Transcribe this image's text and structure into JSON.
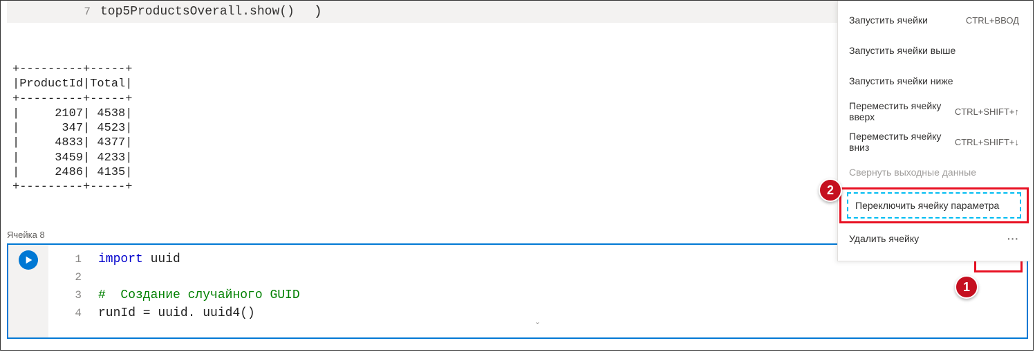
{
  "top_cell": {
    "lineno": "7",
    "code": "top5ProductsOverall.show()",
    "paren": ")"
  },
  "output": "+---------+-----+\n|ProductId|Total|\n+---------+-----+\n|     2107| 4538|\n|      347| 4523|\n|     4833| 4377|\n|     3459| 4233|\n|     2486| 4135|\n+---------+-----+",
  "cell_label": "Ячейка 8",
  "code_cell": {
    "lines": [
      {
        "ln": "1",
        "segments": [
          {
            "t": "import ",
            "c": "kw"
          },
          {
            "t": "uuid",
            "c": "ident"
          }
        ]
      },
      {
        "ln": "2",
        "segments": []
      },
      {
        "ln": "3",
        "segments": [
          {
            "t": "#  Создание случайного GUID",
            "c": "comment"
          }
        ]
      },
      {
        "ln": "4",
        "segments": [
          {
            "t": "runId = uuid. uuid4()",
            "c": "ident"
          }
        ]
      }
    ]
  },
  "ellipsis": "···",
  "menu": {
    "items": [
      {
        "label": "Запустить ячейки",
        "shortcut": "CTRL+ВВОД"
      },
      {
        "label": "Запустить ячейки выше",
        "shortcut": ""
      },
      {
        "label": "Запустить ячейки ниже",
        "shortcut": ""
      },
      {
        "label": "Переместить ячейку вверх",
        "shortcut": "CTRL+SHIFT+↑"
      },
      {
        "label": "Переместить ячейку вниз",
        "shortcut": "CTRL+SHIFT+↓"
      },
      {
        "label": "Свернуть выходные данные",
        "shortcut": "",
        "disabled": true
      },
      {
        "label": "Переключить ячейку параметра",
        "shortcut": "",
        "highlighted": true
      },
      {
        "label": "Удалить ячейку",
        "shortcut": "",
        "trailing_ellipsis": true
      }
    ]
  },
  "badges": {
    "one": "1",
    "two": "2"
  },
  "chevron": "ˇ"
}
